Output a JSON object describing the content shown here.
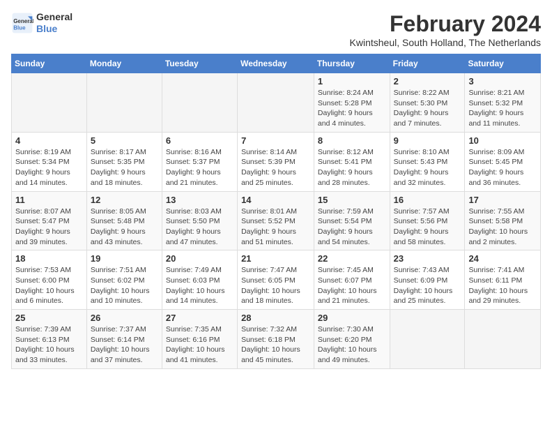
{
  "logo": {
    "line1": "General",
    "line2": "Blue"
  },
  "title": "February 2024",
  "subtitle": "Kwintsheul, South Holland, The Netherlands",
  "days_of_week": [
    "Sunday",
    "Monday",
    "Tuesday",
    "Wednesday",
    "Thursday",
    "Friday",
    "Saturday"
  ],
  "weeks": [
    [
      {
        "day": "",
        "info": ""
      },
      {
        "day": "",
        "info": ""
      },
      {
        "day": "",
        "info": ""
      },
      {
        "day": "",
        "info": ""
      },
      {
        "day": "1",
        "info": "Sunrise: 8:24 AM\nSunset: 5:28 PM\nDaylight: 9 hours\nand 4 minutes."
      },
      {
        "day": "2",
        "info": "Sunrise: 8:22 AM\nSunset: 5:30 PM\nDaylight: 9 hours\nand 7 minutes."
      },
      {
        "day": "3",
        "info": "Sunrise: 8:21 AM\nSunset: 5:32 PM\nDaylight: 9 hours\nand 11 minutes."
      }
    ],
    [
      {
        "day": "4",
        "info": "Sunrise: 8:19 AM\nSunset: 5:34 PM\nDaylight: 9 hours\nand 14 minutes."
      },
      {
        "day": "5",
        "info": "Sunrise: 8:17 AM\nSunset: 5:35 PM\nDaylight: 9 hours\nand 18 minutes."
      },
      {
        "day": "6",
        "info": "Sunrise: 8:16 AM\nSunset: 5:37 PM\nDaylight: 9 hours\nand 21 minutes."
      },
      {
        "day": "7",
        "info": "Sunrise: 8:14 AM\nSunset: 5:39 PM\nDaylight: 9 hours\nand 25 minutes."
      },
      {
        "day": "8",
        "info": "Sunrise: 8:12 AM\nSunset: 5:41 PM\nDaylight: 9 hours\nand 28 minutes."
      },
      {
        "day": "9",
        "info": "Sunrise: 8:10 AM\nSunset: 5:43 PM\nDaylight: 9 hours\nand 32 minutes."
      },
      {
        "day": "10",
        "info": "Sunrise: 8:09 AM\nSunset: 5:45 PM\nDaylight: 9 hours\nand 36 minutes."
      }
    ],
    [
      {
        "day": "11",
        "info": "Sunrise: 8:07 AM\nSunset: 5:47 PM\nDaylight: 9 hours\nand 39 minutes."
      },
      {
        "day": "12",
        "info": "Sunrise: 8:05 AM\nSunset: 5:48 PM\nDaylight: 9 hours\nand 43 minutes."
      },
      {
        "day": "13",
        "info": "Sunrise: 8:03 AM\nSunset: 5:50 PM\nDaylight: 9 hours\nand 47 minutes."
      },
      {
        "day": "14",
        "info": "Sunrise: 8:01 AM\nSunset: 5:52 PM\nDaylight: 9 hours\nand 51 minutes."
      },
      {
        "day": "15",
        "info": "Sunrise: 7:59 AM\nSunset: 5:54 PM\nDaylight: 9 hours\nand 54 minutes."
      },
      {
        "day": "16",
        "info": "Sunrise: 7:57 AM\nSunset: 5:56 PM\nDaylight: 9 hours\nand 58 minutes."
      },
      {
        "day": "17",
        "info": "Sunrise: 7:55 AM\nSunset: 5:58 PM\nDaylight: 10 hours\nand 2 minutes."
      }
    ],
    [
      {
        "day": "18",
        "info": "Sunrise: 7:53 AM\nSunset: 6:00 PM\nDaylight: 10 hours\nand 6 minutes."
      },
      {
        "day": "19",
        "info": "Sunrise: 7:51 AM\nSunset: 6:02 PM\nDaylight: 10 hours\nand 10 minutes."
      },
      {
        "day": "20",
        "info": "Sunrise: 7:49 AM\nSunset: 6:03 PM\nDaylight: 10 hours\nand 14 minutes."
      },
      {
        "day": "21",
        "info": "Sunrise: 7:47 AM\nSunset: 6:05 PM\nDaylight: 10 hours\nand 18 minutes."
      },
      {
        "day": "22",
        "info": "Sunrise: 7:45 AM\nSunset: 6:07 PM\nDaylight: 10 hours\nand 21 minutes."
      },
      {
        "day": "23",
        "info": "Sunrise: 7:43 AM\nSunset: 6:09 PM\nDaylight: 10 hours\nand 25 minutes."
      },
      {
        "day": "24",
        "info": "Sunrise: 7:41 AM\nSunset: 6:11 PM\nDaylight: 10 hours\nand 29 minutes."
      }
    ],
    [
      {
        "day": "25",
        "info": "Sunrise: 7:39 AM\nSunset: 6:13 PM\nDaylight: 10 hours\nand 33 minutes."
      },
      {
        "day": "26",
        "info": "Sunrise: 7:37 AM\nSunset: 6:14 PM\nDaylight: 10 hours\nand 37 minutes."
      },
      {
        "day": "27",
        "info": "Sunrise: 7:35 AM\nSunset: 6:16 PM\nDaylight: 10 hours\nand 41 minutes."
      },
      {
        "day": "28",
        "info": "Sunrise: 7:32 AM\nSunset: 6:18 PM\nDaylight: 10 hours\nand 45 minutes."
      },
      {
        "day": "29",
        "info": "Sunrise: 7:30 AM\nSunset: 6:20 PM\nDaylight: 10 hours\nand 49 minutes."
      },
      {
        "day": "",
        "info": ""
      },
      {
        "day": "",
        "info": ""
      }
    ]
  ]
}
